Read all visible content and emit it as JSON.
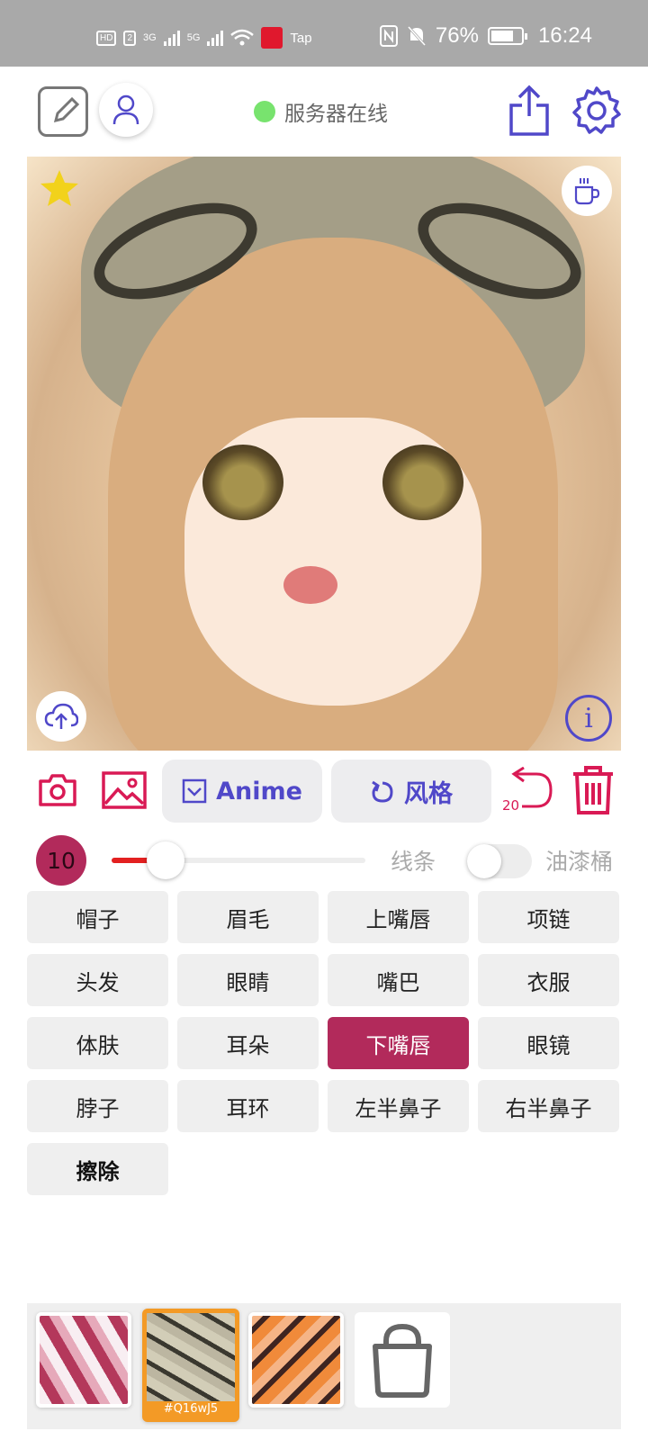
{
  "status_bar": {
    "hd_badge": "HD",
    "sim_badge": "2",
    "net1": "3G",
    "net2": "5G",
    "tap_label": "Tap",
    "battery": "76%",
    "battery_level": 0.76,
    "time": "16:24"
  },
  "header": {
    "server_status": "服务器在线",
    "status_color": "#78e36e"
  },
  "toolbar": {
    "anime_label": "Anime",
    "style_label": "风格",
    "undo_count": "20"
  },
  "brush": {
    "size": "10",
    "slider_level": 0.14,
    "lines_label": "线条",
    "bucket_label": "油漆桶",
    "bucket_enabled": false
  },
  "parts": [
    {
      "label": "帽子"
    },
    {
      "label": "眉毛"
    },
    {
      "label": "上嘴唇"
    },
    {
      "label": "项链"
    },
    {
      "label": "头发"
    },
    {
      "label": "眼睛"
    },
    {
      "label": "嘴巴"
    },
    {
      "label": "衣服"
    },
    {
      "label": "体肤"
    },
    {
      "label": "耳朵"
    },
    {
      "label": "下嘴唇",
      "selected": true
    },
    {
      "label": "眼镜"
    },
    {
      "label": "脖子"
    },
    {
      "label": "耳环"
    },
    {
      "label": "左半鼻子"
    },
    {
      "label": "右半鼻子"
    },
    {
      "label": "擦除",
      "bold": true
    }
  ],
  "swatches": {
    "selected_code": "#Q16wJ5"
  },
  "colors": {
    "accent": "#5048c9",
    "danger": "#d91a55",
    "selected_part": "#b22a5b",
    "selected_swatch_border": "#f39a26"
  }
}
